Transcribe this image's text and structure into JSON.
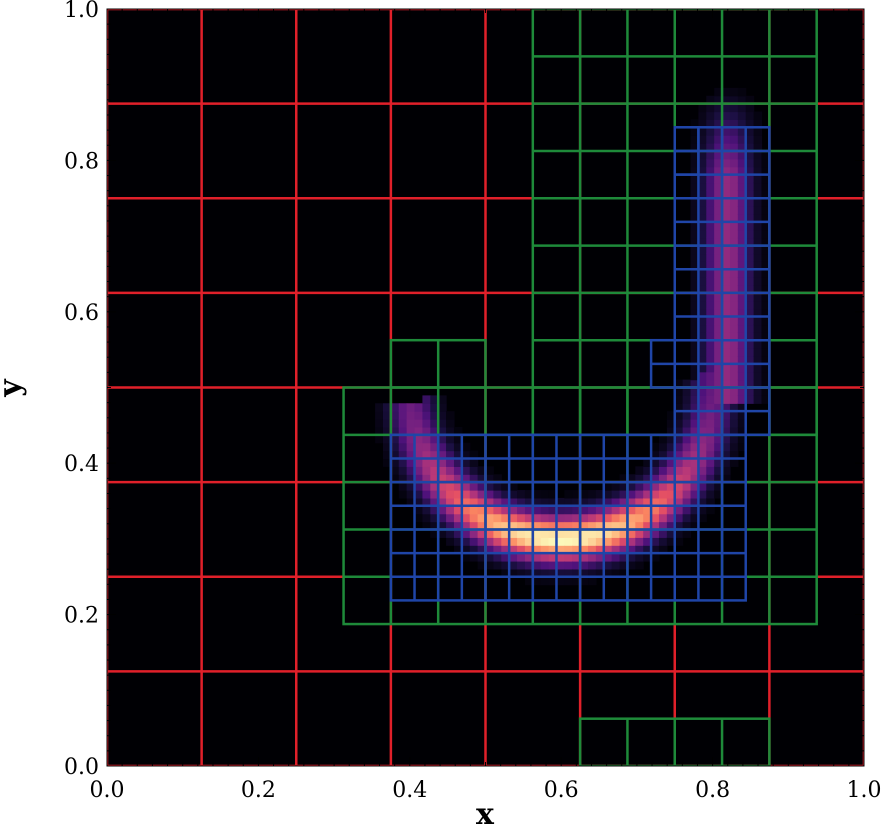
{
  "chart_data": {
    "type": "heatmap",
    "title": "",
    "xlabel": "x",
    "ylabel": "y",
    "xlim": [
      0.0,
      1.0
    ],
    "ylim": [
      0.0,
      1.0
    ],
    "x_ticks": [
      "0.0",
      "0.2",
      "0.4",
      "0.6",
      "0.8",
      "1.0"
    ],
    "y_ticks": [
      "0.0",
      "0.2",
      "0.4",
      "0.6",
      "0.8",
      "1.0"
    ],
    "x_tick_values": [
      0.0,
      0.2,
      0.4,
      0.6,
      0.8,
      1.0
    ],
    "y_tick_values": [
      0.0,
      0.2,
      0.4,
      0.6,
      0.8,
      1.0
    ],
    "colormap": "magma",
    "background_color": "#000004",
    "field": {
      "shape": "hook-shaped band: circular arc centred near (0.6, 0.5) plus a vertical strip at x≈0.82",
      "arc_center": [
        0.6,
        0.5
      ],
      "arc_radius": 0.2,
      "band_width": 0.03,
      "arc_angle_range_deg": [
        0,
        160
      ],
      "peak_point": [
        0.6,
        0.3
      ],
      "vertical_strip_x": 0.82,
      "vertical_strip_y_range": [
        0.5,
        0.86
      ],
      "peak_value": 1.0
    },
    "amr_levels": [
      {
        "level": 0,
        "color": "#e0202a",
        "cell_size": 0.125,
        "boxes": [
          [
            0.0,
            0.0,
            1.0,
            1.0
          ]
        ]
      },
      {
        "level": 1,
        "color": "#1e8a3a",
        "cell_size": 0.0625,
        "boxes": [
          [
            0.5625,
            0.4375,
            0.9375,
            1.0
          ],
          [
            0.375,
            0.5,
            0.5,
            0.5625
          ],
          [
            0.3125,
            0.1875,
            0.9375,
            0.5
          ],
          [
            0.625,
            0.0,
            0.875,
            0.0625
          ]
        ]
      },
      {
        "level": 2,
        "color": "#1f45a8",
        "cell_size": 0.03125,
        "boxes": [
          [
            0.375,
            0.21875,
            0.84375,
            0.4375
          ],
          [
            0.75,
            0.4375,
            0.875,
            0.84375
          ],
          [
            0.71875,
            0.5,
            0.75,
            0.5625
          ],
          [
            0.75,
            0.78125,
            0.78125,
            0.84375
          ]
        ]
      }
    ]
  }
}
